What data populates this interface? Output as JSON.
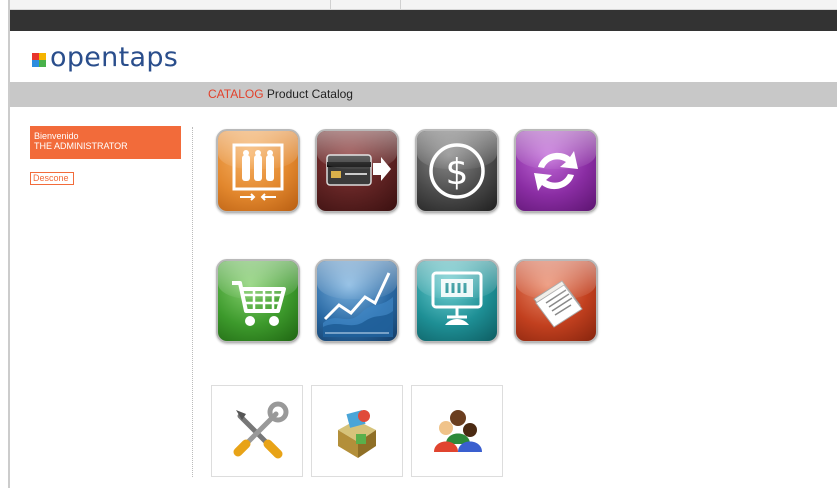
{
  "brand": {
    "name": "opentaps",
    "colors": [
      "#e8352c",
      "#f5b400",
      "#2c8de0",
      "#49b14a"
    ]
  },
  "catalog_bar": {
    "app_label": "CATALOG",
    "title": "Product Catalog"
  },
  "user": {
    "greeting": "Bienvenido",
    "name": "THE ADMINISTRATOR",
    "logout_label": "Descone"
  },
  "app_icons": [
    {
      "name": "warehouse-icon",
      "color": "#e2872d"
    },
    {
      "name": "credit-card-icon",
      "color": "#5e2222"
    },
    {
      "name": "dollar-icon",
      "color": "#4a4a4a"
    },
    {
      "name": "sync-arrows-icon",
      "color": "#8a2da3"
    },
    {
      "name": "shopping-cart-icon",
      "color": "#3d9a2c"
    },
    {
      "name": "line-chart-icon",
      "color": "#2a6aa5"
    },
    {
      "name": "kiosk-monitor-icon",
      "color": "#1e8f95"
    },
    {
      "name": "document-icon",
      "color": "#c2401f"
    }
  ],
  "tool_icons": [
    {
      "name": "wrench-screwdriver-icon"
    },
    {
      "name": "box-puzzle-icon"
    },
    {
      "name": "users-group-icon"
    }
  ]
}
